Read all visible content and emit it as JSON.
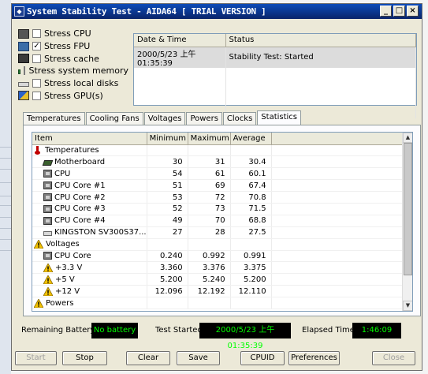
{
  "window": {
    "title": "System Stability Test - AIDA64  [ TRIAL VERSION ]"
  },
  "stress": [
    {
      "label": "Stress CPU",
      "checked": false,
      "icon": "cpu-icon"
    },
    {
      "label": "Stress FPU",
      "checked": true,
      "icon": "fpu-icon"
    },
    {
      "label": "Stress cache",
      "checked": false,
      "icon": "cache-icon"
    },
    {
      "label": "Stress system memory",
      "checked": false,
      "icon": "memory-icon"
    },
    {
      "label": "Stress local disks",
      "checked": false,
      "icon": "disk-icon"
    },
    {
      "label": "Stress GPU(s)",
      "checked": false,
      "icon": "gpu-icon"
    }
  ],
  "log": {
    "col_datetime": "Date & Time",
    "col_status": "Status",
    "rows": [
      {
        "datetime": "2000/5/23 上午 01:35:39",
        "status": "Stability Test: Started"
      }
    ]
  },
  "tabs": [
    "Temperatures",
    "Cooling Fans",
    "Voltages",
    "Powers",
    "Clocks",
    "Statistics"
  ],
  "active_tab": "Statistics",
  "stats": {
    "headers": {
      "item": "Item",
      "min": "Minimum",
      "max": "Maximum",
      "avg": "Average"
    },
    "rows": [
      {
        "kind": "group",
        "icon": "thermometer-icon",
        "label": "Temperatures",
        "min": "",
        "max": "",
        "avg": ""
      },
      {
        "kind": "item",
        "icon": "motherboard-icon",
        "label": "Motherboard",
        "min": "30",
        "max": "31",
        "avg": "30.4"
      },
      {
        "kind": "item",
        "icon": "cpu-chip-icon",
        "label": "CPU",
        "min": "54",
        "max": "61",
        "avg": "60.1"
      },
      {
        "kind": "item",
        "icon": "cpu-chip-icon",
        "label": "CPU Core #1",
        "min": "51",
        "max": "69",
        "avg": "67.4"
      },
      {
        "kind": "item",
        "icon": "cpu-chip-icon",
        "label": "CPU Core #2",
        "min": "53",
        "max": "72",
        "avg": "70.8"
      },
      {
        "kind": "item",
        "icon": "cpu-chip-icon",
        "label": "CPU Core #3",
        "min": "52",
        "max": "73",
        "avg": "71.5"
      },
      {
        "kind": "item",
        "icon": "cpu-chip-icon",
        "label": "CPU Core #4",
        "min": "49",
        "max": "70",
        "avg": "68.8"
      },
      {
        "kind": "item",
        "icon": "disk-drive-icon",
        "label": "KINGSTON SV300S37...",
        "min": "27",
        "max": "28",
        "avg": "27.5"
      },
      {
        "kind": "group",
        "icon": "warning-icon",
        "label": "Voltages",
        "min": "",
        "max": "",
        "avg": ""
      },
      {
        "kind": "item",
        "icon": "cpu-chip-icon",
        "label": "CPU Core",
        "min": "0.240",
        "max": "0.992",
        "avg": "0.991"
      },
      {
        "kind": "item",
        "icon": "warning-icon",
        "label": "+3.3 V",
        "min": "3.360",
        "max": "3.376",
        "avg": "3.375"
      },
      {
        "kind": "item",
        "icon": "warning-icon",
        "label": "+5 V",
        "min": "5.200",
        "max": "5.240",
        "avg": "5.200"
      },
      {
        "kind": "item",
        "icon": "warning-icon",
        "label": "+12 V",
        "min": "12.096",
        "max": "12.192",
        "avg": "12.110"
      },
      {
        "kind": "group",
        "icon": "warning-icon",
        "label": "Powers",
        "min": "",
        "max": "",
        "avg": ""
      }
    ]
  },
  "status": {
    "battery_label": "Remaining Battery:",
    "battery_value": "No battery",
    "started_label": "Test Started:",
    "started_value": "2000/5/23 上午 01:35:39",
    "elapsed_label": "Elapsed Time:",
    "elapsed_value": "1:46:09"
  },
  "buttons": {
    "start": "Start",
    "stop": "Stop",
    "clear": "Clear",
    "save": "Save",
    "cpuid": "CPUID",
    "preferences": "Preferences",
    "close": "Close"
  },
  "colors": {
    "lcd_bg": "#000000",
    "lcd_fg": "#00ff00",
    "titlebar": "#0a246a"
  }
}
